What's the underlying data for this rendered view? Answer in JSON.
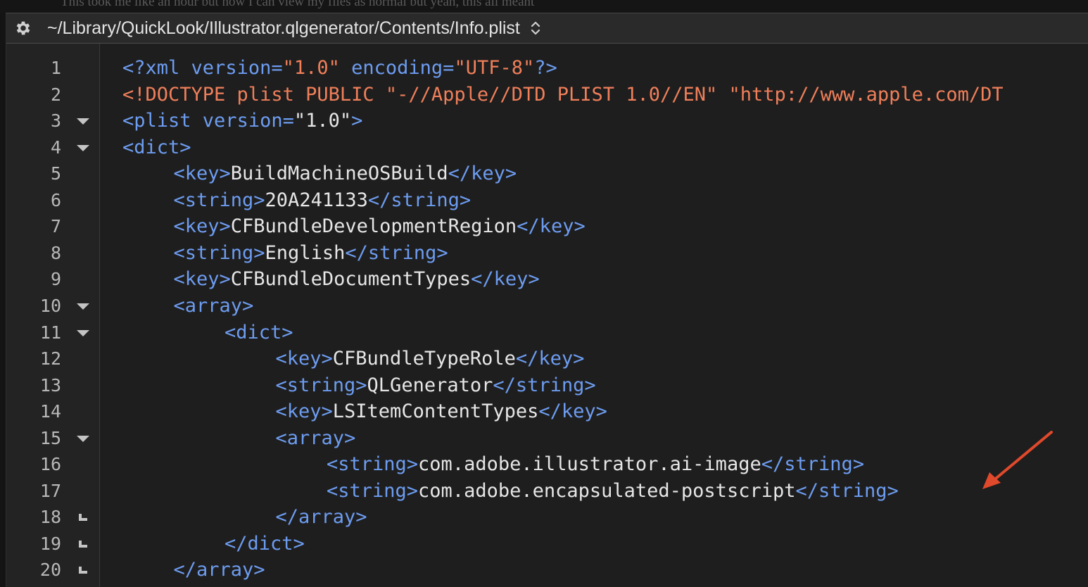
{
  "page": {
    "background_caption": "This took me like an hour but now I can view my files as normal but yeah, this all meant"
  },
  "pathbar": {
    "path": "~/Library/QuickLook/Illustrator.qlgenerator/Contents/Info.plist",
    "gear_icon": "gear-icon",
    "stepper_icon": "up-down-chevron-icon"
  },
  "colors": {
    "tag": "#6d9cf0",
    "text": "#e6e6e6",
    "string_literal": "#f07f5a",
    "arrow": "#e0492b"
  },
  "lines": [
    {
      "n": "1",
      "fold": "",
      "indent": 0,
      "parts": [
        [
          "pi",
          "<?xml "
        ],
        [
          "pi",
          "version="
        ],
        [
          "str",
          "\"1.0\""
        ],
        [
          "pi",
          " encoding="
        ],
        [
          "str",
          "\"UTF-8\""
        ],
        [
          "pi",
          "?>"
        ]
      ]
    },
    {
      "n": "2",
      "fold": "",
      "indent": 0,
      "parts": [
        [
          "str",
          "<!DOCTYPE plist PUBLIC \"-//Apple//DTD PLIST 1.0//EN\" \"http://www.apple.com/DT"
        ]
      ]
    },
    {
      "n": "3",
      "fold": "open",
      "indent": 0,
      "parts": [
        [
          "tag",
          "<plist "
        ],
        [
          "tag",
          "version="
        ],
        [
          "txt",
          "\"1.0\""
        ],
        [
          "tag",
          ">"
        ]
      ]
    },
    {
      "n": "4",
      "fold": "open",
      "indent": 0,
      "parts": [
        [
          "tag",
          "<dict>"
        ]
      ]
    },
    {
      "n": "5",
      "fold": "",
      "indent": 1,
      "parts": [
        [
          "tag",
          "<key>"
        ],
        [
          "txt",
          "BuildMachineOSBuild"
        ],
        [
          "tag",
          "</key>"
        ]
      ]
    },
    {
      "n": "6",
      "fold": "",
      "indent": 1,
      "parts": [
        [
          "tag",
          "<string>"
        ],
        [
          "txt",
          "20A241133"
        ],
        [
          "tag",
          "</string>"
        ]
      ]
    },
    {
      "n": "7",
      "fold": "",
      "indent": 1,
      "parts": [
        [
          "tag",
          "<key>"
        ],
        [
          "txt",
          "CFBundleDevelopmentRegion"
        ],
        [
          "tag",
          "</key>"
        ]
      ]
    },
    {
      "n": "8",
      "fold": "",
      "indent": 1,
      "parts": [
        [
          "tag",
          "<string>"
        ],
        [
          "txt",
          "English"
        ],
        [
          "tag",
          "</string>"
        ]
      ]
    },
    {
      "n": "9",
      "fold": "",
      "indent": 1,
      "parts": [
        [
          "tag",
          "<key>"
        ],
        [
          "txt",
          "CFBundleDocumentTypes"
        ],
        [
          "tag",
          "</key>"
        ]
      ]
    },
    {
      "n": "10",
      "fold": "open",
      "indent": 1,
      "parts": [
        [
          "tag",
          "<array>"
        ]
      ]
    },
    {
      "n": "11",
      "fold": "open",
      "indent": 2,
      "parts": [
        [
          "tag",
          "<dict>"
        ]
      ]
    },
    {
      "n": "12",
      "fold": "",
      "indent": 3,
      "parts": [
        [
          "tag",
          "<key>"
        ],
        [
          "txt",
          "CFBundleTypeRole"
        ],
        [
          "tag",
          "</key>"
        ]
      ]
    },
    {
      "n": "13",
      "fold": "",
      "indent": 3,
      "parts": [
        [
          "tag",
          "<string>"
        ],
        [
          "txt",
          "QLGenerator"
        ],
        [
          "tag",
          "</string>"
        ]
      ]
    },
    {
      "n": "14",
      "fold": "",
      "indent": 3,
      "parts": [
        [
          "tag",
          "<key>"
        ],
        [
          "txt",
          "LSItemContentTypes"
        ],
        [
          "tag",
          "</key>"
        ]
      ]
    },
    {
      "n": "15",
      "fold": "open",
      "indent": 3,
      "parts": [
        [
          "tag",
          "<array>"
        ]
      ]
    },
    {
      "n": "16",
      "fold": "",
      "indent": 4,
      "parts": [
        [
          "tag",
          "<string>"
        ],
        [
          "txt",
          "com.adobe.illustrator.ai-image"
        ],
        [
          "tag",
          "</string>"
        ]
      ]
    },
    {
      "n": "17",
      "fold": "",
      "indent": 4,
      "parts": [
        [
          "tag",
          "<string>"
        ],
        [
          "txt",
          "com.adobe.encapsulated-postscript"
        ],
        [
          "tag",
          "</string>"
        ]
      ]
    },
    {
      "n": "18",
      "fold": "end",
      "indent": 3,
      "parts": [
        [
          "tag",
          "</array>"
        ]
      ]
    },
    {
      "n": "19",
      "fold": "end",
      "indent": 2,
      "parts": [
        [
          "tag",
          "</dict>"
        ]
      ]
    },
    {
      "n": "20",
      "fold": "end",
      "indent": 1,
      "parts": [
        [
          "tag",
          "</array>"
        ]
      ]
    }
  ]
}
